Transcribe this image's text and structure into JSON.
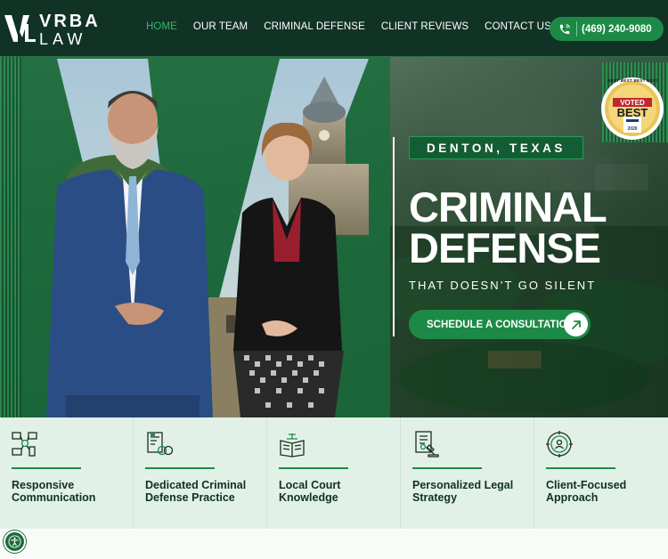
{
  "brand": {
    "line1": "VRBA",
    "line2": "LAW",
    "accent": "#1c8a46",
    "dark": "#113325"
  },
  "nav": {
    "items": [
      {
        "label": "HOME",
        "active": true
      },
      {
        "label": "OUR TEAM",
        "active": false
      },
      {
        "label": "CRIMINAL DEFENSE",
        "active": false
      },
      {
        "label": "CLIENT REVIEWS",
        "active": false
      },
      {
        "label": "CONTACT US",
        "active": false
      }
    ]
  },
  "phone": {
    "label": "(469) 240-9080",
    "icon": "phone-icon"
  },
  "hero": {
    "location": "DENTON, TEXAS",
    "headline_line1": "CRIMINAL",
    "headline_line2": "DEFENSE",
    "tagline": "THAT DOESN’T GO SILENT",
    "cta_label": "SCHEDULE A CONSULTATION",
    "cta_icon": "arrow-up-right-icon"
  },
  "badge": {
    "top": "VOTED",
    "main": "BEST",
    "ring_text": "BEST BEST BEST BEST",
    "year": "2026"
  },
  "features": [
    {
      "title": "Responsive Communication",
      "icon": "network-devices-icon"
    },
    {
      "title": "Dedicated Criminal Defense Practice",
      "icon": "handcuffs-document-icon"
    },
    {
      "title": "Local Court Knowledge",
      "icon": "law-book-icon"
    },
    {
      "title": "Personalized Legal Strategy",
      "icon": "gavel-document-icon"
    },
    {
      "title": "Client-Focused Approach",
      "icon": "client-target-icon"
    }
  ],
  "accessibility": {
    "icon": "accessibility-icon"
  }
}
